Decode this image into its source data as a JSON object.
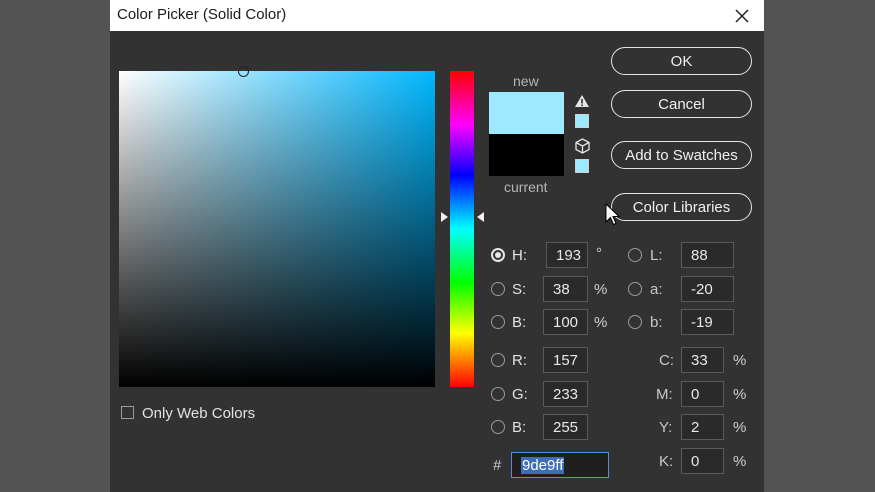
{
  "window": {
    "title": "Color Picker (Solid Color)"
  },
  "preview": {
    "new_label": "new",
    "current_label": "current",
    "new_color": "#9de9ff",
    "current_color": "#000000"
  },
  "buttons": {
    "ok": "OK",
    "cancel": "Cancel",
    "add_swatches": "Add to Swatches",
    "color_libraries": "Color Libraries"
  },
  "hsb": {
    "h": {
      "label": "H:",
      "value": "193",
      "unit": "°"
    },
    "s": {
      "label": "S:",
      "value": "38",
      "unit": "%"
    },
    "b": {
      "label": "B:",
      "value": "100",
      "unit": "%"
    }
  },
  "lab": {
    "l": {
      "label": "L:",
      "value": "88"
    },
    "a": {
      "label": "a:",
      "value": "-20"
    },
    "b": {
      "label": "b:",
      "value": "-19"
    }
  },
  "rgb": {
    "r": {
      "label": "R:",
      "value": "157"
    },
    "g": {
      "label": "G:",
      "value": "233"
    },
    "b": {
      "label": "B:",
      "value": "255"
    }
  },
  "cmyk": {
    "c": {
      "label": "C:",
      "value": "33",
      "unit": "%"
    },
    "m": {
      "label": "M:",
      "value": "0",
      "unit": "%"
    },
    "y": {
      "label": "Y:",
      "value": "2",
      "unit": "%"
    },
    "k": {
      "label": "K:",
      "value": "0",
      "unit": "%"
    }
  },
  "hex": {
    "label": "#",
    "value": "9de9ff"
  },
  "web_colors": {
    "label": "Only Web Colors",
    "checked": false
  },
  "icons": {
    "close": "close-icon",
    "gamut_warning": "warning-triangle-icon",
    "web_safe": "cube-icon",
    "cursor": "mouse-pointer-icon"
  }
}
